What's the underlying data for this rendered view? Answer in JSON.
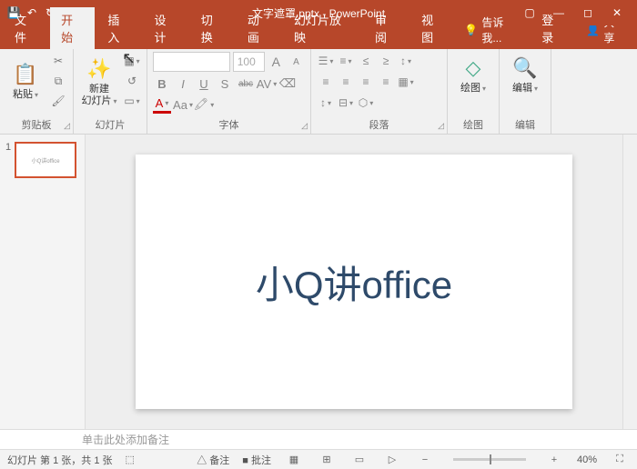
{
  "title": "文字遮罩.pptx - PowerPoint",
  "qat": {
    "save": "💾",
    "undo": "↶",
    "redo": "↻",
    "start": "▷"
  },
  "tabs": {
    "file": "文件",
    "home": "开始",
    "insert": "插入",
    "design": "设计",
    "transitions": "切换",
    "animations": "动画",
    "slideshow": "幻灯片放映",
    "review": "审阅",
    "view": "视图",
    "tellme_icon": "💡",
    "tellme": "告诉我...",
    "login": "登录",
    "share_icon": "👤",
    "share": "共享"
  },
  "groups": {
    "clipboard": {
      "label": "剪贴板",
      "paste": "粘贴",
      "cut": "✂",
      "copy": "⧉",
      "painter": "🖌"
    },
    "slides": {
      "label": "幻灯片",
      "new": "新建\n幻灯片",
      "layout": "▦",
      "reset": "↺",
      "section": "▭"
    },
    "font": {
      "label": "字体",
      "size": "100",
      "bold": "B",
      "italic": "I",
      "underline": "U",
      "shadow": "S",
      "strike": "abc",
      "spacing": "AV",
      "clear": "Aa",
      "color": "A",
      "size_up": "A",
      "size_dn": "A"
    },
    "para": {
      "label": "段落"
    },
    "drawing": {
      "label": "绘图",
      "shapes": "绘图"
    },
    "editing": {
      "label": "编辑",
      "find": "编辑"
    }
  },
  "slide_text": "小Q讲office",
  "thumb_num": "1",
  "notes_placeholder": "单击此处添加备注",
  "status": {
    "slide": "幻灯片 第 1 张，共 1 张",
    "lang": "⬚",
    "notes": "△ 备注",
    "comments": "■ 批注",
    "zoom": "40%",
    "fit": "⛶"
  }
}
